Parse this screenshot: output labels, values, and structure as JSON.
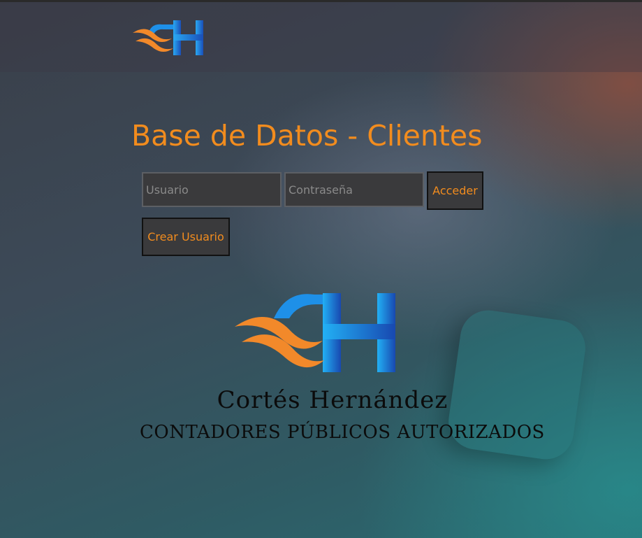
{
  "header": {
    "logo_icon": "ch-logo-icon"
  },
  "main": {
    "title": "Base de Datos - Clientes",
    "user_placeholder": "Usuario",
    "pass_placeholder": "Contraseña",
    "login_label": "Acceder",
    "create_label": "Crear Usuario"
  },
  "brand": {
    "logo_icon": "ch-logo-icon",
    "name": "Cortés Hernández",
    "tagline": "CONTADORES PÚBLICOS AUTORIZADOS"
  },
  "colors": {
    "accent": "#f28c1e",
    "logo_blue": "#1e88e5",
    "logo_orange": "#f2892a",
    "input_bg": "#3a3a3c"
  }
}
